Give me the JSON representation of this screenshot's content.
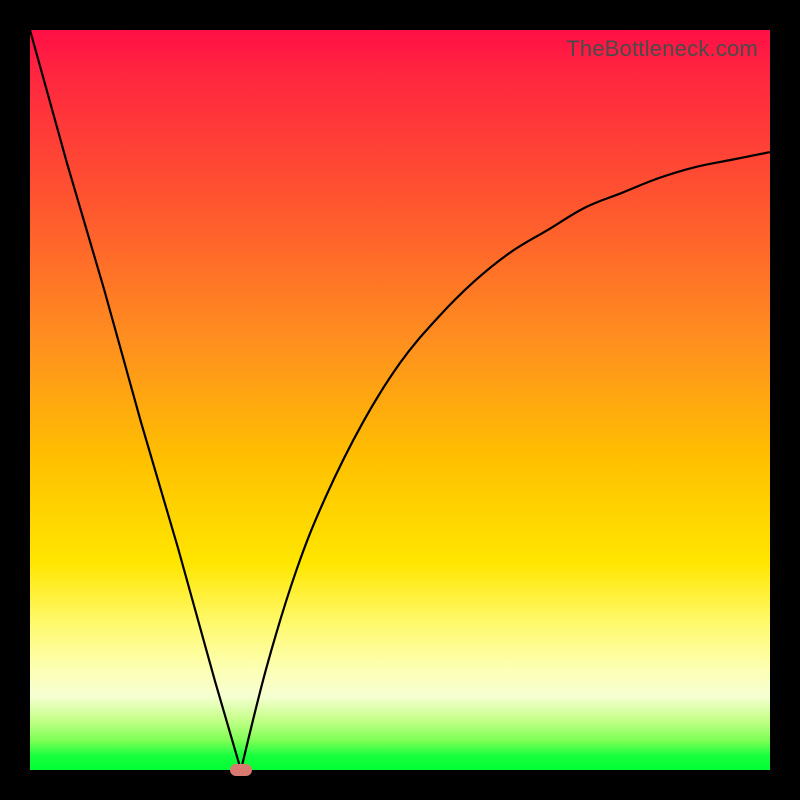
{
  "watermark": "TheBottleneck.com",
  "colors": {
    "curve": "#000000",
    "frame": "#000000",
    "marker": "#d87a6f"
  },
  "chart_data": {
    "type": "line",
    "title": "",
    "xlabel": "",
    "ylabel": "",
    "xlim": [
      0,
      100
    ],
    "ylim": [
      0,
      100
    ],
    "grid": false,
    "legend": false,
    "note": "V-shaped bottleneck curve over a vertical red→green gradient. Values estimated from pixel positions; axes are unlabeled.",
    "series": [
      {
        "name": "line-left",
        "x": [
          0,
          5,
          10,
          15,
          20,
          25,
          28.5
        ],
        "values": [
          100,
          82,
          65,
          47,
          30,
          12,
          0
        ]
      },
      {
        "name": "line-right",
        "x": [
          28.5,
          32,
          36,
          40,
          45,
          50,
          55,
          60,
          65,
          70,
          75,
          80,
          85,
          90,
          95,
          100
        ],
        "values": [
          0,
          14,
          27,
          37,
          47,
          55,
          61,
          66,
          70,
          73,
          76,
          78,
          80,
          81.5,
          82.5,
          83.5
        ]
      }
    ],
    "marker": {
      "x": 28.5,
      "y": 0,
      "label": ""
    }
  }
}
